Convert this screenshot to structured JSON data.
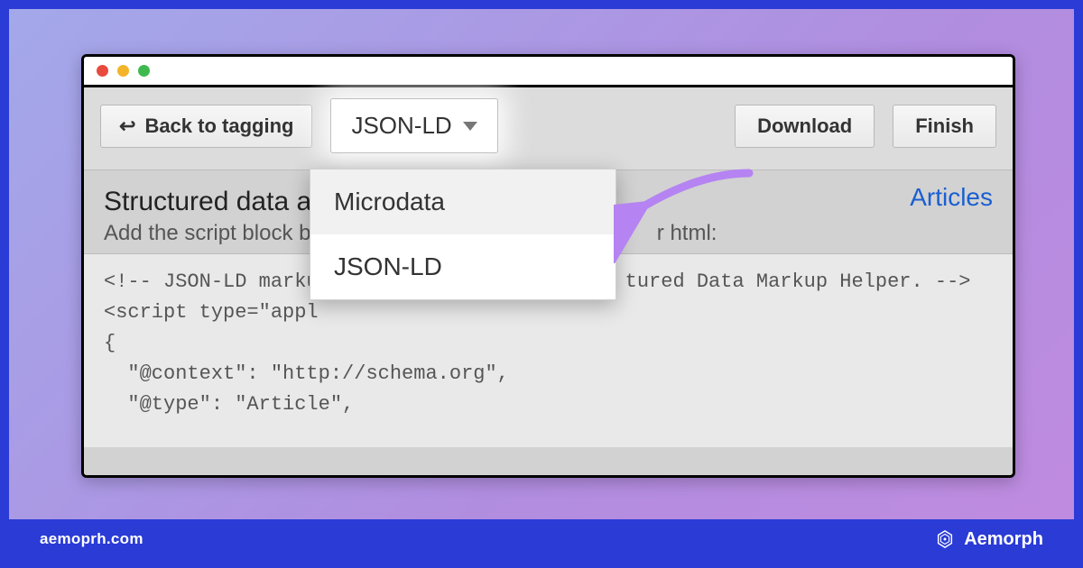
{
  "toolbar": {
    "back_label": "Back to tagging",
    "format_label": "JSON-LD",
    "download_label": "Download",
    "finish_label": "Finish"
  },
  "dropdown": {
    "items": [
      "Microdata",
      "JSON-LD"
    ],
    "highlighted_index": 0
  },
  "section": {
    "heading_visible": "Structured data a",
    "sub_visible_left": "Add the script block b",
    "sub_visible_right": "r html:",
    "link_label": "Articles"
  },
  "code": {
    "line1_left": "<!-- JSON-LD marku",
    "line1_right": "tured Data Markup Helper. -->",
    "line2_left": "<script type=\"appl",
    "line3": "{",
    "line4": "  \"@context\": \"http://schema.org\",",
    "line5": "  \"@type\": \"Article\","
  },
  "annotation": {
    "arrow_color": "#b583f2"
  },
  "footer": {
    "url": "aemoprh.com",
    "brand": "Aemorph"
  }
}
